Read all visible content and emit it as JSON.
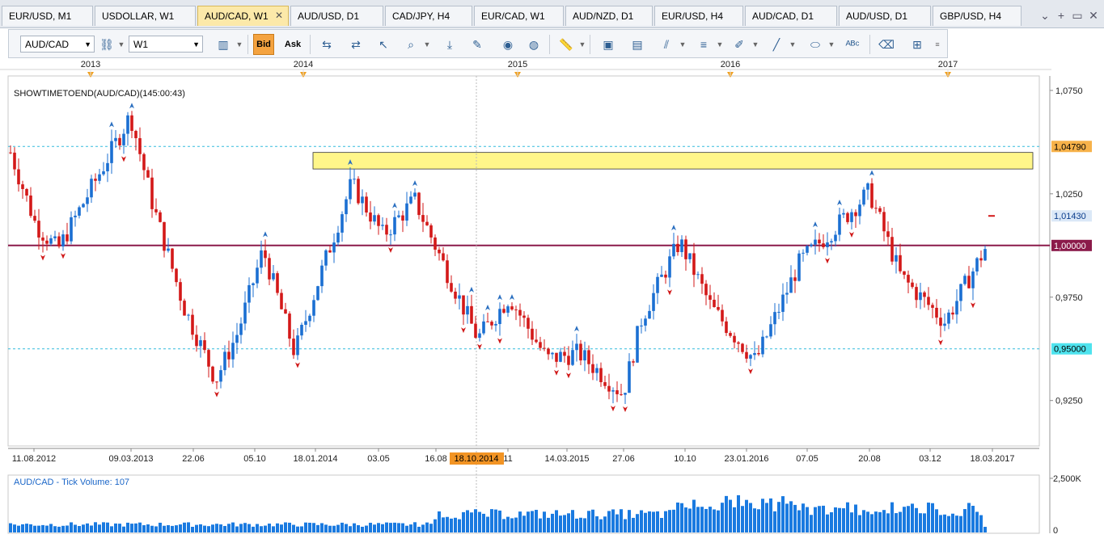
{
  "tabs": [
    {
      "label": "EUR/USD, M1"
    },
    {
      "label": "USDOLLAR, W1"
    },
    {
      "label": "AUD/CAD, W1",
      "active": true
    },
    {
      "label": "AUD/USD, D1"
    },
    {
      "label": "CAD/JPY, H4"
    },
    {
      "label": "EUR/CAD, W1"
    },
    {
      "label": "AUD/NZD, D1"
    },
    {
      "label": "EUR/USD, H4"
    },
    {
      "label": "AUD/CAD, D1"
    },
    {
      "label": "AUD/USD, D1"
    },
    {
      "label": "GBP/USD, H4"
    }
  ],
  "tab_close_glyph": "✕",
  "tab_controls": [
    "⌄",
    "+",
    "▭",
    "✕"
  ],
  "toolbar": {
    "symbol": "AUD/CAD",
    "timeframe": "W1",
    "bid_label": "Bid",
    "ask_label": "Ask",
    "icons": [
      "link-icon",
      "cursor-icon",
      "crosshair-icon",
      "zoom-icon",
      "arrow-down-icon",
      "edit-icon",
      "eye-icon",
      "globe-icon",
      "ruler-icon",
      "image-icon",
      "layout-icon",
      "fibonacci-icon",
      "lines-icon",
      "pen-icon",
      "trendline-icon",
      "ellipse-icon",
      "text-icon",
      "eraser-icon",
      "hierarchy-icon",
      "more-icon"
    ]
  },
  "chart": {
    "indicator_label": "SHOWTIMETOEND(AUD/CAD)(145:00:43)",
    "volume_label": "AUD/CAD - Tick Volume: 107",
    "year_labels": [
      "2013",
      "2014",
      "2015",
      "2016",
      "2017"
    ],
    "date_labels": [
      "11.08.2012",
      "09.03.2013",
      "22.06",
      "05.10",
      "18.01.2014",
      "03.05",
      "16.08",
      "11",
      "14.03.2015",
      "27.06",
      "10.10",
      "23.01.2016",
      "07.05",
      "20.08",
      "03.12",
      "18.03.2017"
    ],
    "cursor_date": "18.10.2014",
    "price_axis": {
      "ticks": [
        "1,0750",
        "1,0250",
        "0,9750",
        "0,9250"
      ],
      "levels": [
        {
          "label": "1,04790",
          "style": "orange",
          "value": 1.0479
        },
        {
          "label": "1,01430",
          "style": "blue",
          "value": 1.0143
        },
        {
          "label": "1,00000",
          "style": "maroon",
          "value": 1.0
        },
        {
          "label": "0,95000",
          "style": "cyan",
          "value": 0.95
        }
      ]
    },
    "volume_axis": [
      "2,500K",
      "0"
    ],
    "colors": {
      "bull": "#1b6fd2",
      "bear": "#d31919",
      "zone": "#fff68a",
      "hline": "#8b1a4a",
      "dash": "#33bbdd"
    },
    "resistance_zone": {
      "from": "2014-03",
      "to": "2017-03",
      "top": 1.045,
      "bottom": 1.037
    }
  }
}
